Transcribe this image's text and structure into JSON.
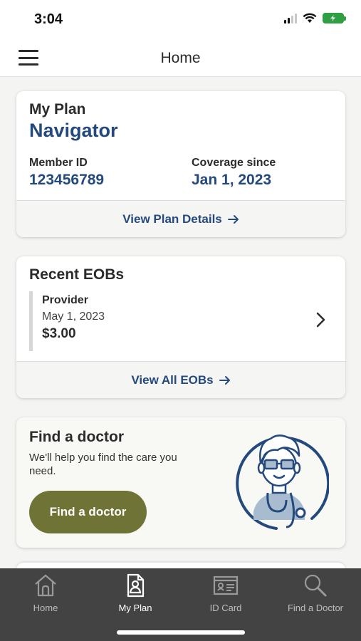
{
  "status": {
    "time": "3:04"
  },
  "header": {
    "title": "Home"
  },
  "plan": {
    "label": "My Plan",
    "name": "Navigator",
    "member_id_label": "Member ID",
    "member_id": "123456789",
    "coverage_label": "Coverage since",
    "coverage_date": "Jan 1, 2023",
    "details_link": "View Plan Details"
  },
  "eobs": {
    "title": "Recent EOBs",
    "item": {
      "provider": "Provider",
      "date": "May 1, 2023",
      "amount": "$3.00"
    },
    "view_all": "View All EOBs"
  },
  "find_doctor": {
    "title": "Find a doctor",
    "subtitle": "We'll help you find the care you need.",
    "button": "Find a doctor"
  },
  "tabs": [
    {
      "label": "Home",
      "icon": "home-icon",
      "active": false
    },
    {
      "label": "My Plan",
      "icon": "document-person-icon",
      "active": true
    },
    {
      "label": "ID Card",
      "icon": "id-card-icon",
      "active": false
    },
    {
      "label": "Find a Doctor",
      "icon": "search-icon",
      "active": false
    }
  ],
  "colors": {
    "accent_blue": "#24497c",
    "button_olive": "#6f7436",
    "tab_bar": "#434343"
  }
}
